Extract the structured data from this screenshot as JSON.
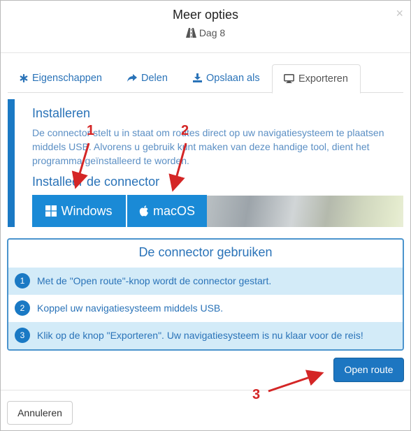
{
  "header": {
    "title": "Meer opties",
    "subtitle": "Dag 8",
    "close_symbol": "×",
    "subtitle_icon": "road-icon"
  },
  "tabs": [
    {
      "label": "Eigenschappen",
      "icon": "asterisk-icon"
    },
    {
      "label": "Delen",
      "icon": "share-icon"
    },
    {
      "label": "Opslaan als",
      "icon": "download-icon"
    },
    {
      "label": "Exporteren",
      "icon": "desktop-icon",
      "active": true
    }
  ],
  "install": {
    "heading": "Installeren",
    "description": "De connector stelt u in staat om routes direct op uw navigatiesysteem te plaatsen middels USB. Alvorens u gebruik kunt maken van deze handige tool, dient het programma geïnstalleerd te worden.",
    "subheading": "Installeer de connector",
    "windows_label": "Windows",
    "macos_label": "macOS"
  },
  "usage": {
    "heading": "De connector gebruiken",
    "steps": [
      {
        "number": "1",
        "text": "Met de \"Open route\"-knop wordt de connector gestart."
      },
      {
        "number": "2",
        "text": "Koppel uw navigatiesysteem middels USB."
      },
      {
        "number": "3",
        "text": "Klik op de knop \"Exporteren\". Uw navigatiesysteem is nu klaar voor de reis!"
      }
    ]
  },
  "actions": {
    "open_route_label": "Open route",
    "cancel_label": "Annuleren"
  },
  "annotations": {
    "mark_1": "1",
    "mark_2": "2",
    "mark_3": "3"
  },
  "colors": {
    "accent": "#1a79c4",
    "link": "#2a73b8",
    "button": "#1a8ad6",
    "annotation": "#d42626",
    "row_highlight": "#d3ebf8"
  }
}
